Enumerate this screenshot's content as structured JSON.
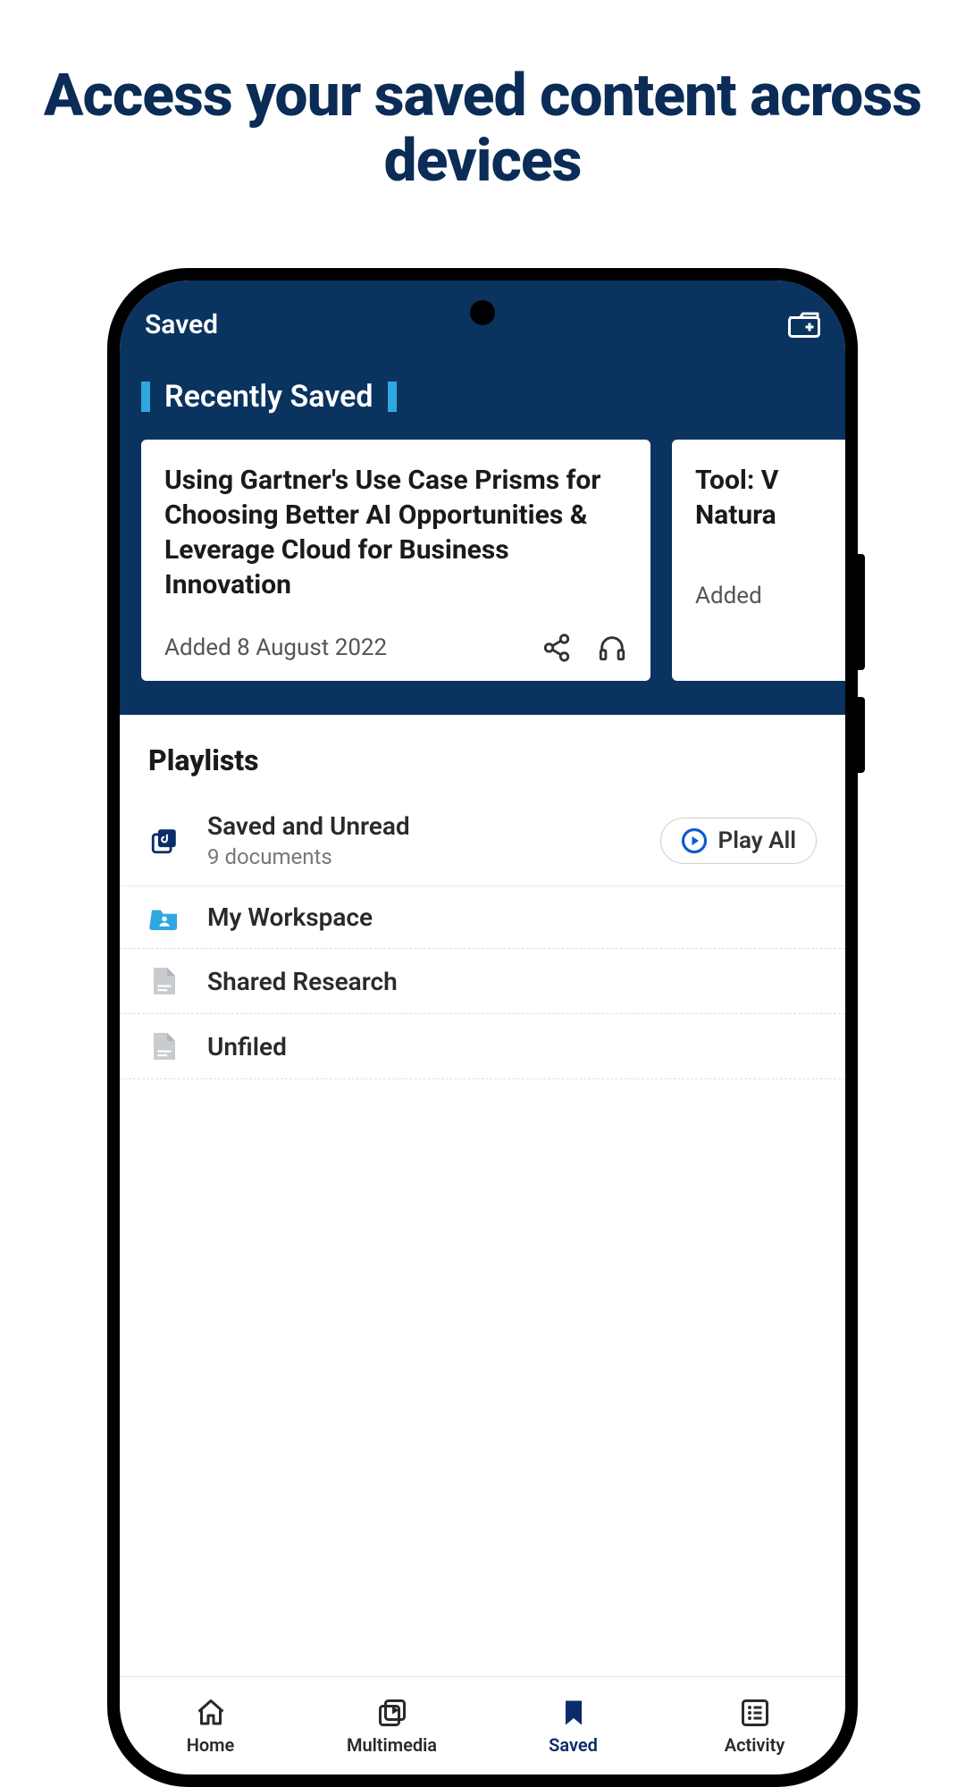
{
  "promo": {
    "heading": "Access your saved content across devices"
  },
  "header": {
    "title": "Saved"
  },
  "recently": {
    "title": "Recently Saved",
    "cards": [
      {
        "title": "Using Gartner's Use Case Prisms for Choosing Better AI Opportunities & Leverage Cloud for Business Innovation",
        "added": "Added 8 August 2022"
      },
      {
        "title": "Tool: V\nNatura",
        "added": "Added"
      }
    ]
  },
  "playlists": {
    "heading": "Playlists",
    "play_all": "Play All",
    "items": [
      {
        "title": "Saved and Unread",
        "sub": "9 documents"
      },
      {
        "title": "My Workspace"
      },
      {
        "title": "Shared Research"
      },
      {
        "title": "Unfiled"
      }
    ]
  },
  "nav": {
    "home": "Home",
    "multimedia": "Multimedia",
    "saved": "Saved",
    "activity": "Activity"
  }
}
